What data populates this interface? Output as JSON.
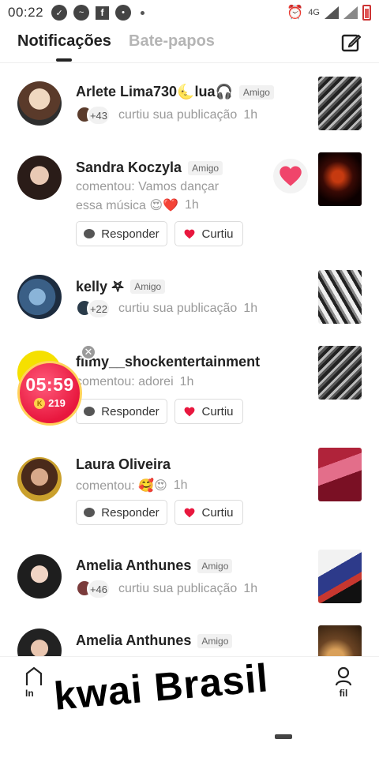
{
  "status_bar": {
    "time": "00:22",
    "network": "4G"
  },
  "tabs": [
    {
      "label": "Notificações",
      "active": true
    },
    {
      "label": "Bate-papos",
      "active": false
    }
  ],
  "notifications": [
    {
      "name": "Arlete Lima730🌜lua🎧",
      "badge": "Amigo",
      "count": "+43",
      "text": "curtiu sua publicação",
      "time": "1h"
    },
    {
      "name": "Sandra Koczyla",
      "badge": "Amigo",
      "text_line1": "comentou: Vamos dançar",
      "text_line2": "essa música 😍❤️",
      "time": "1h",
      "reply_label": "Responder",
      "like_label": "Curtiu"
    },
    {
      "name": "kelly 𖤐",
      "badge": "Amigo",
      "count": "+22",
      "text": "curtiu sua publicação",
      "time": "1h"
    },
    {
      "name": "filmy__shockentertainment",
      "text": "comentou: adorei",
      "time": "1h",
      "reply_label": "Responder",
      "like_label": "Curtiu"
    },
    {
      "name": "Laura Oliveira",
      "text": "comentou: 🥰😍",
      "time": "1h",
      "reply_label": "Responder",
      "like_label": "Curtiu"
    },
    {
      "name": "Amelia Anthunes",
      "badge": "Amigo",
      "count": "+46",
      "text": "curtiu sua publicação",
      "time": "1h"
    },
    {
      "name": "Amelia Anthunes",
      "badge": "Amigo"
    }
  ],
  "timer": {
    "time": "05:59",
    "coin_symbol": "K",
    "coins": "219"
  },
  "bottom_nav": {
    "left_label": "In",
    "right_label": "fil"
  },
  "overlay_caption": "kwai Brasil",
  "colors": {
    "heart": "#e8173e",
    "timer_bg": "#e8173e",
    "timer_border": "#ffd25a"
  }
}
